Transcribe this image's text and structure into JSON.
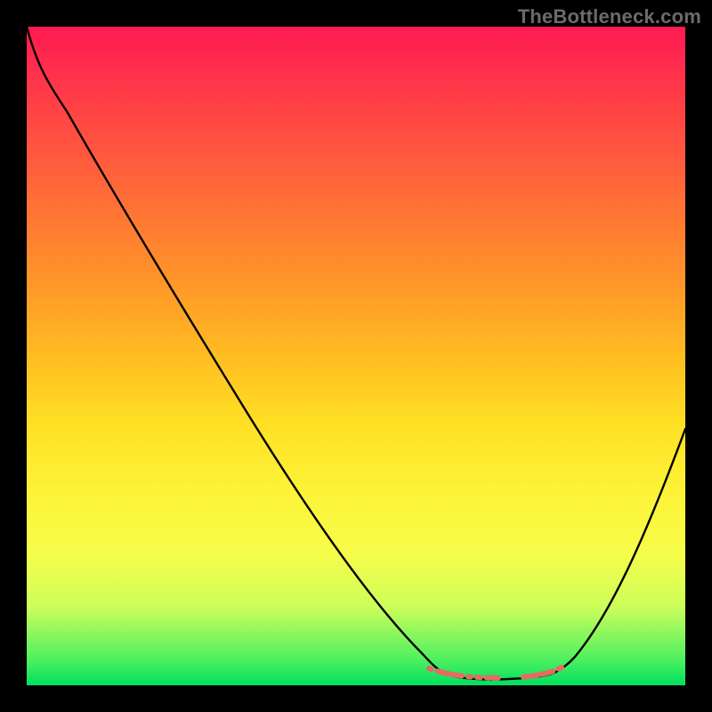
{
  "watermark": "TheBottleneck.com",
  "chart_data": {
    "type": "line",
    "title": "",
    "xlabel": "",
    "ylabel": "",
    "ylim": [
      0,
      100
    ],
    "x": [
      0.0,
      0.05,
      0.1,
      0.15,
      0.2,
      0.25,
      0.3,
      0.35,
      0.4,
      0.45,
      0.5,
      0.55,
      0.6,
      0.625,
      0.65,
      0.7,
      0.75,
      0.8,
      0.85,
      0.9,
      0.95,
      1.0
    ],
    "series": [
      {
        "name": "bottleneck-curve",
        "color": "#000000",
        "values": [
          100,
          94,
          87,
          79,
          71,
          63,
          55,
          47,
          39,
          31,
          23,
          15,
          7,
          3,
          1,
          0,
          0,
          2,
          7,
          15,
          26,
          39
        ]
      },
      {
        "name": "optimal-range-marker",
        "color": "#e76a63",
        "flat_region_x": [
          0.625,
          0.8
        ],
        "flat_region_y": 1.5
      }
    ],
    "gradient_stops": [
      {
        "pos": 0.0,
        "color": "#ff1a52"
      },
      {
        "pos": 0.5,
        "color": "#ffbd22"
      },
      {
        "pos": 0.8,
        "color": "#f6fd4a"
      },
      {
        "pos": 1.0,
        "color": "#00e060"
      }
    ]
  }
}
